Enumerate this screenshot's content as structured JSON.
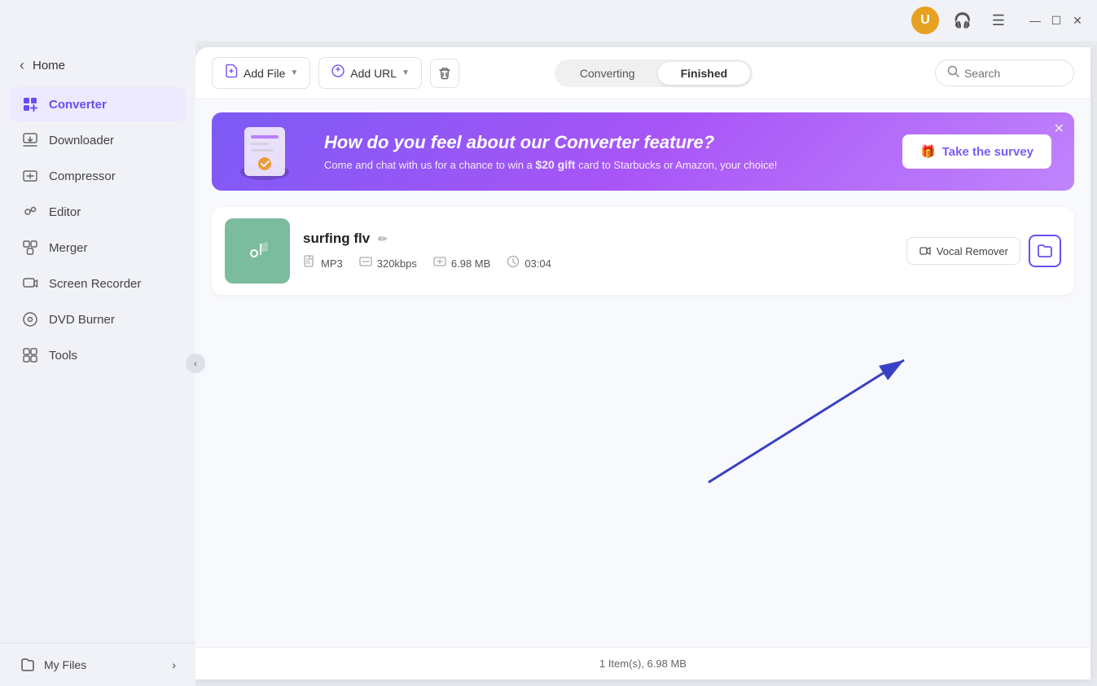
{
  "titlebar": {
    "avatar_initial": "U",
    "headphone_icon": "🎧",
    "menu_icon": "☰",
    "minimize_icon": "—",
    "maximize_icon": "☐",
    "close_icon": "✕"
  },
  "sidebar": {
    "home_label": "Home",
    "back_arrow": "‹",
    "nav_items": [
      {
        "id": "converter",
        "label": "Converter",
        "icon": "⬛",
        "active": true
      },
      {
        "id": "downloader",
        "label": "Downloader",
        "icon": "⬇",
        "active": false
      },
      {
        "id": "compressor",
        "label": "Compressor",
        "icon": "⬛",
        "active": false
      },
      {
        "id": "editor",
        "label": "Editor",
        "icon": "✂",
        "active": false
      },
      {
        "id": "merger",
        "label": "Merger",
        "icon": "⬛",
        "active": false
      },
      {
        "id": "screen-recorder",
        "label": "Screen Recorder",
        "icon": "📷",
        "active": false
      },
      {
        "id": "dvd-burner",
        "label": "DVD Burner",
        "icon": "💿",
        "active": false
      },
      {
        "id": "tools",
        "label": "Tools",
        "icon": "⬛",
        "active": false
      }
    ],
    "my_files_label": "My Files",
    "my_files_arrow": "›",
    "collapse_icon": "‹"
  },
  "toolbar": {
    "add_file_label": "Add File",
    "add_url_label": "Add URL",
    "delete_icon": "🗑",
    "tab_converting": "Converting",
    "tab_finished": "Finished",
    "search_placeholder": "Search",
    "active_tab": "finished"
  },
  "banner": {
    "title": "How do you feel about our Converter feature?",
    "subtitle": "Come and chat with us for a chance to win a",
    "gift_text": "$20 gift",
    "subtitle2": "card to Starbucks or Amazon, your choice!",
    "survey_btn_label": "Take the survey",
    "close_icon": "✕"
  },
  "file": {
    "name": "surfing flv",
    "format": "MP3",
    "bitrate": "320kbps",
    "size": "6.98 MB",
    "duration": "03:04",
    "vocal_remover_label": "Vocal Remover",
    "edit_icon": "✏"
  },
  "status_bar": {
    "text": "1 Item(s), 6.98 MB"
  },
  "colors": {
    "accent": "#6b4ef0",
    "banner_gradient_start": "#7c5af5",
    "banner_gradient_end": "#c084fc",
    "active_nav_bg": "#ede9ff",
    "active_nav_text": "#6b4ef0",
    "thumb_bg": "#7cbc9e"
  }
}
